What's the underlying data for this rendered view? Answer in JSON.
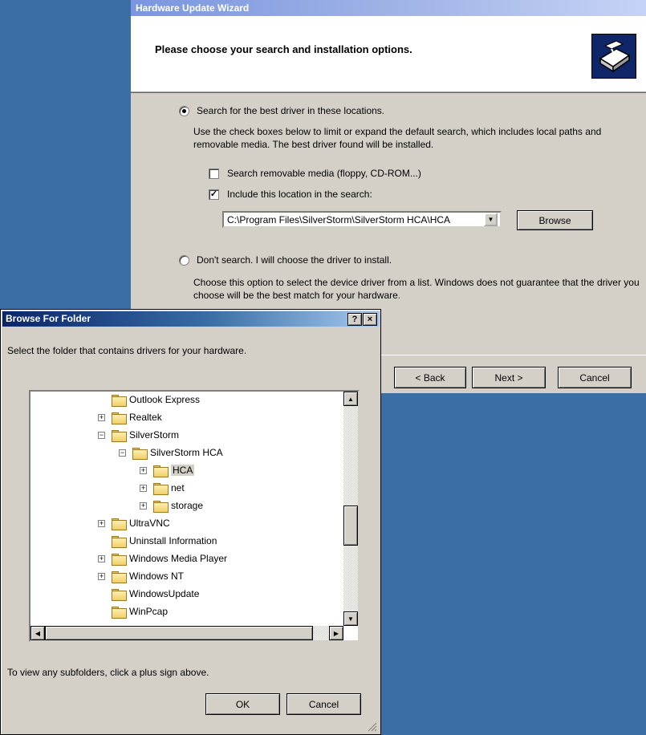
{
  "wizard": {
    "title": "Hardware Update Wizard",
    "heading": "Please choose your search and installation options.",
    "logo_icon": "hardware-wizard-icon",
    "option_search": {
      "label": "Search for the best driver in these locations.",
      "selected": true,
      "description": "Use the check boxes below to limit or expand the default search, which includes local paths and removable media. The best driver found will be installed."
    },
    "check_removable": {
      "label": "Search removable media (floppy, CD-ROM...)",
      "checked": false
    },
    "check_location": {
      "label": "Include this location in the search:",
      "checked": true
    },
    "location_value": "C:\\Program Files\\SilverStorm\\SilverStorm HCA\\HCA",
    "browse_label": "Browse",
    "option_dont_search": {
      "label": "Don't search. I will choose the driver to install.",
      "selected": false,
      "description": "Choose this option to select the device driver from a list.  Windows does not guarantee that the driver you choose will be the best match for your hardware."
    },
    "back_label": "< Back",
    "next_label": "Next >",
    "cancel_label": "Cancel"
  },
  "browse": {
    "title": "Browse For Folder",
    "help_label": "?",
    "close_label": "×",
    "instruction": "Select the folder that contains drivers for your hardware.",
    "tree": [
      {
        "label": "Outlook Express",
        "level": 0,
        "expander": "none"
      },
      {
        "label": "Realtek",
        "level": 0,
        "expander": "plus"
      },
      {
        "label": "SilverStorm",
        "level": 0,
        "expander": "minus"
      },
      {
        "label": "SilverStorm HCA",
        "level": 1,
        "expander": "minus"
      },
      {
        "label": "HCA",
        "level": 2,
        "expander": "plus",
        "selected": true
      },
      {
        "label": "net",
        "level": 2,
        "expander": "plus"
      },
      {
        "label": "storage",
        "level": 2,
        "expander": "plus"
      },
      {
        "label": "UltraVNC",
        "level": 0,
        "expander": "plus"
      },
      {
        "label": "Uninstall Information",
        "level": 0,
        "expander": "none"
      },
      {
        "label": "Windows Media Player",
        "level": 0,
        "expander": "plus"
      },
      {
        "label": "Windows NT",
        "level": 0,
        "expander": "plus"
      },
      {
        "label": "WindowsUpdate",
        "level": 0,
        "expander": "none"
      },
      {
        "label": "WinPcap",
        "level": 0,
        "expander": "none"
      }
    ],
    "hint": "To view any subfolders, click a plus sign above.",
    "ok_label": "OK",
    "cancel_label": "Cancel"
  },
  "colors": {
    "desktop": "#3a6ea5",
    "dialog_face": "#d4d0c8",
    "active_title": "#0a246a",
    "inactive_title": "#7a96df"
  }
}
